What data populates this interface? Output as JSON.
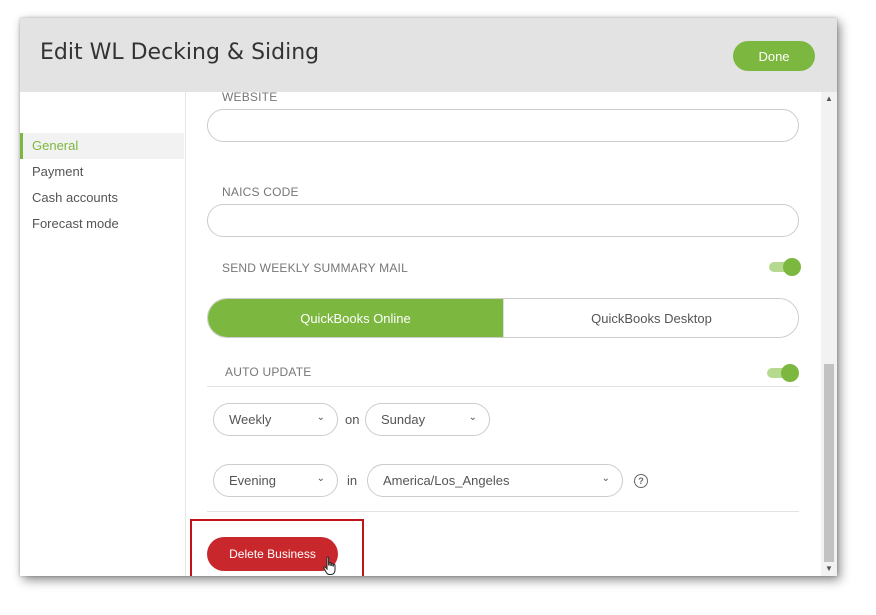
{
  "dialog": {
    "title": "Edit WL Decking & Siding",
    "done_label": "Done"
  },
  "sidebar": {
    "items": [
      {
        "label": "General",
        "active": true
      },
      {
        "label": "Payment",
        "active": false
      },
      {
        "label": "Cash accounts",
        "active": false
      },
      {
        "label": "Forecast mode",
        "active": false
      }
    ]
  },
  "form": {
    "website": {
      "label": "WEBSITE",
      "value": "",
      "placeholder": ""
    },
    "naics": {
      "label": "NAICS CODE",
      "value": "",
      "placeholder": ""
    },
    "weekly_summary": {
      "label": "SEND WEEKLY SUMMARY MAIL",
      "enabled": true
    },
    "source": {
      "options": [
        "QuickBooks Online",
        "QuickBooks Desktop"
      ],
      "selected": "QuickBooks Online"
    },
    "auto_update": {
      "label": "AUTO UPDATE",
      "enabled": true,
      "frequency": "Weekly",
      "on_word": "on",
      "day": "Sunday",
      "time_of_day": "Evening",
      "in_word": "in",
      "timezone": "America/Los_Angeles"
    },
    "delete_label": "Delete Business"
  },
  "icons": {
    "chevron": "chevron-down-icon",
    "help": "question-circle-icon",
    "cursor": "hand-pointer-icon"
  },
  "colors": {
    "accent": "#7cb83f",
    "danger": "#c8282c",
    "highlight": "#c0141b"
  }
}
